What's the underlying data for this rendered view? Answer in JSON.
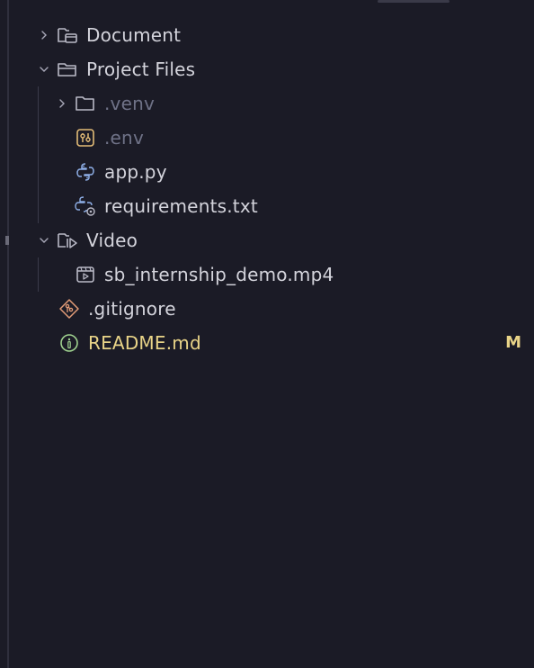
{
  "explorer": {
    "items": [
      {
        "label": "Document",
        "icon": "folder-document-icon",
        "chevron": "chevron-right-icon",
        "level": 0
      },
      {
        "label": "Project Files",
        "icon": "folder-open-icon",
        "chevron": "chevron-down-icon",
        "level": 0
      },
      {
        "label": ".venv",
        "icon": "folder-icon",
        "chevron": "chevron-right-icon",
        "level": 1
      },
      {
        "label": ".env",
        "icon": "env-file-icon",
        "level": 1
      },
      {
        "label": "app.py",
        "icon": "python-icon",
        "level": 1
      },
      {
        "label": "requirements.txt",
        "icon": "python-requirements-icon",
        "level": 1
      },
      {
        "label": "Video",
        "icon": "folder-video-icon",
        "chevron": "chevron-down-icon",
        "level": 0
      },
      {
        "label": "sb_internship_demo.mp4",
        "icon": "video-file-icon",
        "level": 1
      },
      {
        "label": ".gitignore",
        "icon": "git-icon",
        "level": 0
      },
      {
        "label": "README.md",
        "icon": "info-icon",
        "level": 0,
        "git_status": "M"
      }
    ]
  },
  "colors": {
    "background": "#1b1b26",
    "text": "#d4d4dc",
    "ignored_text": "#6f7287",
    "modified_text": "#e9d488",
    "folder_icon": "#b9b9c6",
    "env_icon": "#e3bc77",
    "python_icon": "#8fb0e8",
    "git_icon": "#e39c77",
    "info_icon": "#9fd28f"
  }
}
